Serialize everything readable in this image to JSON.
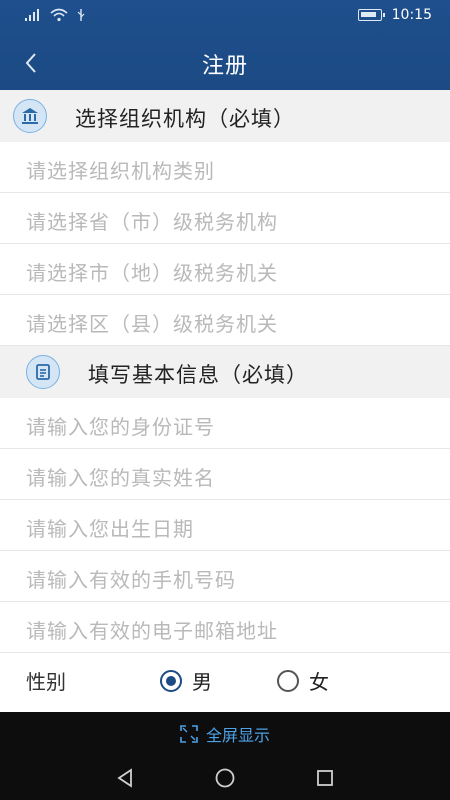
{
  "status": {
    "time": "10:15"
  },
  "header": {
    "title": "注册"
  },
  "sections": [
    {
      "title": "选择组织机构（必填）",
      "icon": "bank-icon",
      "rows": [
        "请选择组织机构类别",
        "请选择省（市）级税务机构",
        "请选择市（地）级税务机关",
        "请选择区（县）级税务机关"
      ]
    },
    {
      "title": "填写基本信息（必填）",
      "icon": "document-icon",
      "rows": [
        "请输入您的身份证号",
        "请输入您的真实姓名",
        "请输入您出生日期",
        "请输入有效的手机号码",
        "请输入有效的电子邮箱地址"
      ]
    }
  ],
  "gender": {
    "label": "性别",
    "male": "男",
    "female": "女",
    "selected": "男"
  },
  "fullscreen": {
    "label": "全屏显示"
  },
  "colors": {
    "header": "#1b4a84",
    "accent": "#4da1e6",
    "placeholder": "#b9b9b9"
  }
}
